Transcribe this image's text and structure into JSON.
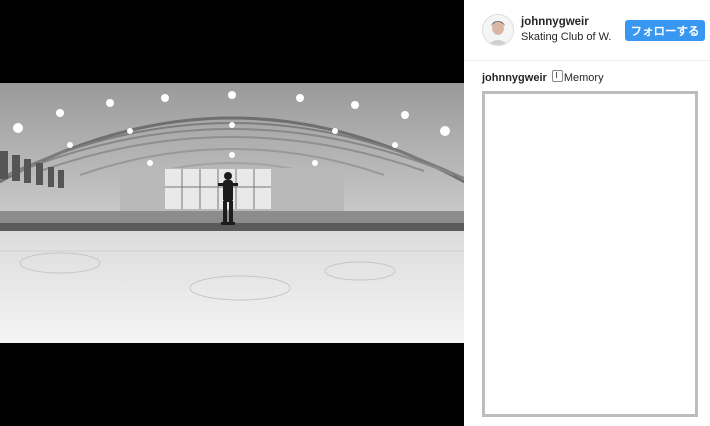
{
  "post": {
    "username": "johnnygweir",
    "location": "Skating Club of W.",
    "follow_label": "フォローする",
    "caption_user": "johnnygweir",
    "caption_text": "Memory",
    "caption_icon": "music-note-icon"
  },
  "colors": {
    "follow_button": "#3897f0",
    "media_background": "#000000",
    "comment_box_border": "#bdbdbd"
  }
}
